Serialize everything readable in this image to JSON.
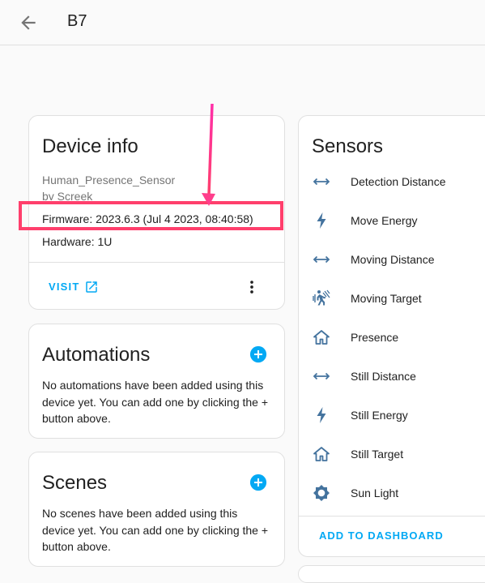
{
  "header": {
    "title": "B7",
    "back_icon": "arrow-left-icon"
  },
  "device_info": {
    "title": "Device info",
    "model": "Human_Presence_Sensor",
    "maker": "by Screek",
    "firmware": "Firmware: 2023.6.3 (Jul 4 2023, 08:40:58)",
    "hardware": "Hardware: 1U",
    "visit_label": "VISIT"
  },
  "automations": {
    "title": "Automations",
    "description": "No automations have been added using this device yet. You can add one by clicking the + button above."
  },
  "scenes": {
    "title": "Scenes",
    "description": "No scenes have been added using this device yet. You can add one by clicking the + button above."
  },
  "sensors": {
    "title": "Sensors",
    "items": [
      {
        "label": "Detection Distance",
        "icon": "arrow-left-right-icon"
      },
      {
        "label": "Move Energy",
        "icon": "flash-icon"
      },
      {
        "label": "Moving Distance",
        "icon": "arrow-left-right-icon"
      },
      {
        "label": "Moving Target",
        "icon": "motion-sensor-icon"
      },
      {
        "label": "Presence",
        "icon": "home-outline-icon"
      },
      {
        "label": "Still Distance",
        "icon": "arrow-left-right-icon"
      },
      {
        "label": "Still Energy",
        "icon": "flash-icon"
      },
      {
        "label": "Still Target",
        "icon": "home-outline-icon"
      },
      {
        "label": "Sun Light",
        "icon": "brightness-icon"
      }
    ],
    "add_to_dashboard": "ADD TO DASHBOARD"
  },
  "colors": {
    "accent": "#03a9f4",
    "icon": "#44739e",
    "annotation": "#ff3f6c"
  }
}
